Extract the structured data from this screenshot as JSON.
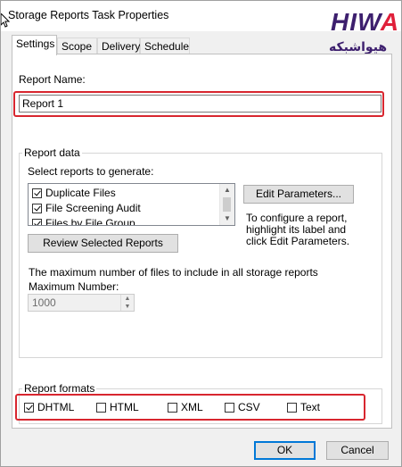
{
  "window": {
    "title": "Storage Reports Task Properties"
  },
  "tabs": [
    {
      "label": "Settings",
      "active": true
    },
    {
      "label": "Scope",
      "active": false
    },
    {
      "label": "Delivery",
      "active": false
    },
    {
      "label": "Schedule",
      "active": false
    }
  ],
  "report_name": {
    "label": "Report Name:",
    "value": "Report 1"
  },
  "report_data": {
    "group_title": "Report data",
    "select_label": "Select reports to generate:",
    "reports": [
      {
        "label": "Duplicate Files",
        "checked": true
      },
      {
        "label": "File Screening Audit",
        "checked": true
      },
      {
        "label": "Files by File Group",
        "checked": true
      }
    ],
    "edit_parameters_label": "Edit Parameters...",
    "hint_lines": [
      "To configure a report,",
      "highlight its label and",
      "click Edit Parameters."
    ],
    "review_label": "Review Selected Reports",
    "max_files_text": "The maximum number of files to include in all storage reports",
    "max_number_label": "Maximum Number:",
    "max_number_value": "1000"
  },
  "report_formats": {
    "group_title": "Report formats",
    "formats": [
      {
        "label": "DHTML",
        "checked": true
      },
      {
        "label": "HTML",
        "checked": false
      },
      {
        "label": "XML",
        "checked": false
      },
      {
        "label": "CSV",
        "checked": false
      },
      {
        "label": "Text",
        "checked": false
      }
    ]
  },
  "footer": {
    "ok_label": "OK",
    "cancel_label": "Cancel"
  },
  "watermark": {
    "latin": "HIWA",
    "persian": "هیواشبکه"
  },
  "colors": {
    "highlight": "#d8262f",
    "logo": "#3d1f6e",
    "primary_border": "#0078d7"
  }
}
